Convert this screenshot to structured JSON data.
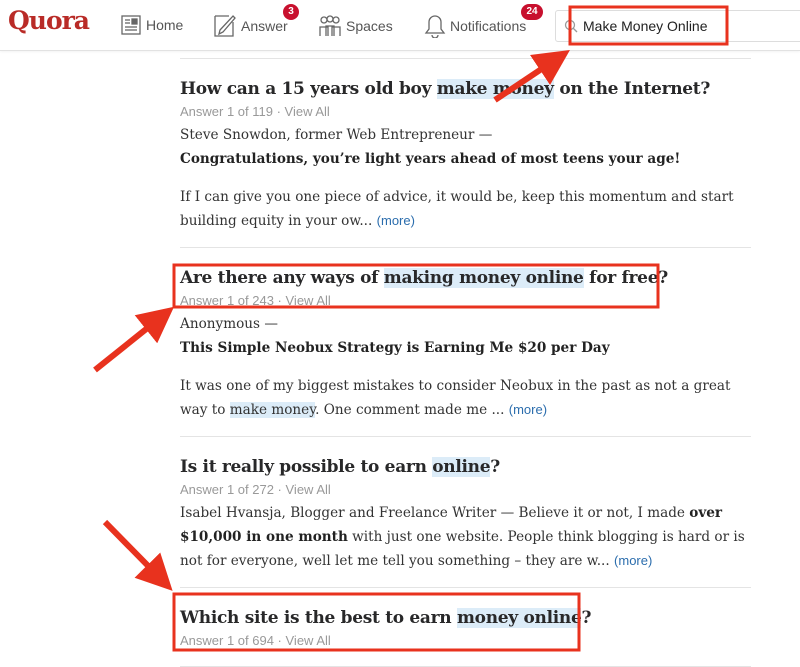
{
  "header": {
    "logo": "Quora",
    "nav": [
      {
        "label": "Home",
        "icon": "news-feed-icon"
      },
      {
        "label": "Answer",
        "icon": "pencil-icon",
        "badge": "3"
      },
      {
        "label": "Spaces",
        "icon": "people-icon"
      },
      {
        "label": "Notifications",
        "icon": "bell-icon",
        "badge": "24"
      }
    ],
    "search_value": "Make Money Online"
  },
  "colors": {
    "brand": "#b92b27",
    "highlight": "#dcecf8",
    "annotation": "#e8321e",
    "link": "#2b6dad"
  },
  "questions": [
    {
      "title": [
        {
          "t": "How can a 15 years old boy "
        },
        {
          "t": "make money",
          "hl": true
        },
        {
          "t": " on the Internet?"
        }
      ],
      "meta": "Answer 1 of 119 · View All",
      "author": "Steve Snowdon, former Web Entrepreneur —",
      "headline": "Congratulations, you’re light years ahead of most teens your age!",
      "body": [
        {
          "t": "If I can give you one piece of advice, it would be, keep this momentum and start building equity in your ow... "
        }
      ],
      "more": "(more)"
    },
    {
      "title": [
        {
          "t": "Are there any ways of "
        },
        {
          "t": "making money online",
          "hl": true
        },
        {
          "t": " for free?"
        }
      ],
      "meta": "Answer 1 of 243 · View All",
      "author": "Anonymous —",
      "headline": "This Simple Neobux Strategy is Earning Me $20 per Day",
      "body": [
        {
          "t": "It was one of my biggest mistakes to consider Neobux in the past as not a great way to "
        },
        {
          "t": "make money",
          "hl": true
        },
        {
          "t": ". One comment made me ... "
        }
      ],
      "more": "(more)"
    },
    {
      "title": [
        {
          "t": "Is it really possible to earn "
        },
        {
          "t": "online",
          "hl": true
        },
        {
          "t": "?"
        }
      ],
      "meta": "Answer 1 of 272 · View All",
      "body": [
        {
          "t": "Isabel Hvansja, Blogger and Freelance Writer —  Believe it or not, I made "
        },
        {
          "t": "over $10,000 in one month",
          "b": true
        },
        {
          "t": " with just one website. People think blogging is hard or is not for everyone, well let me tell you something – they are w... "
        }
      ],
      "more": "(more)"
    },
    {
      "title": [
        {
          "t": "Which site is the best to earn "
        },
        {
          "t": "money online",
          "hl": true
        },
        {
          "t": "?"
        }
      ],
      "meta": "Answer 1 of 694 · View All"
    }
  ]
}
